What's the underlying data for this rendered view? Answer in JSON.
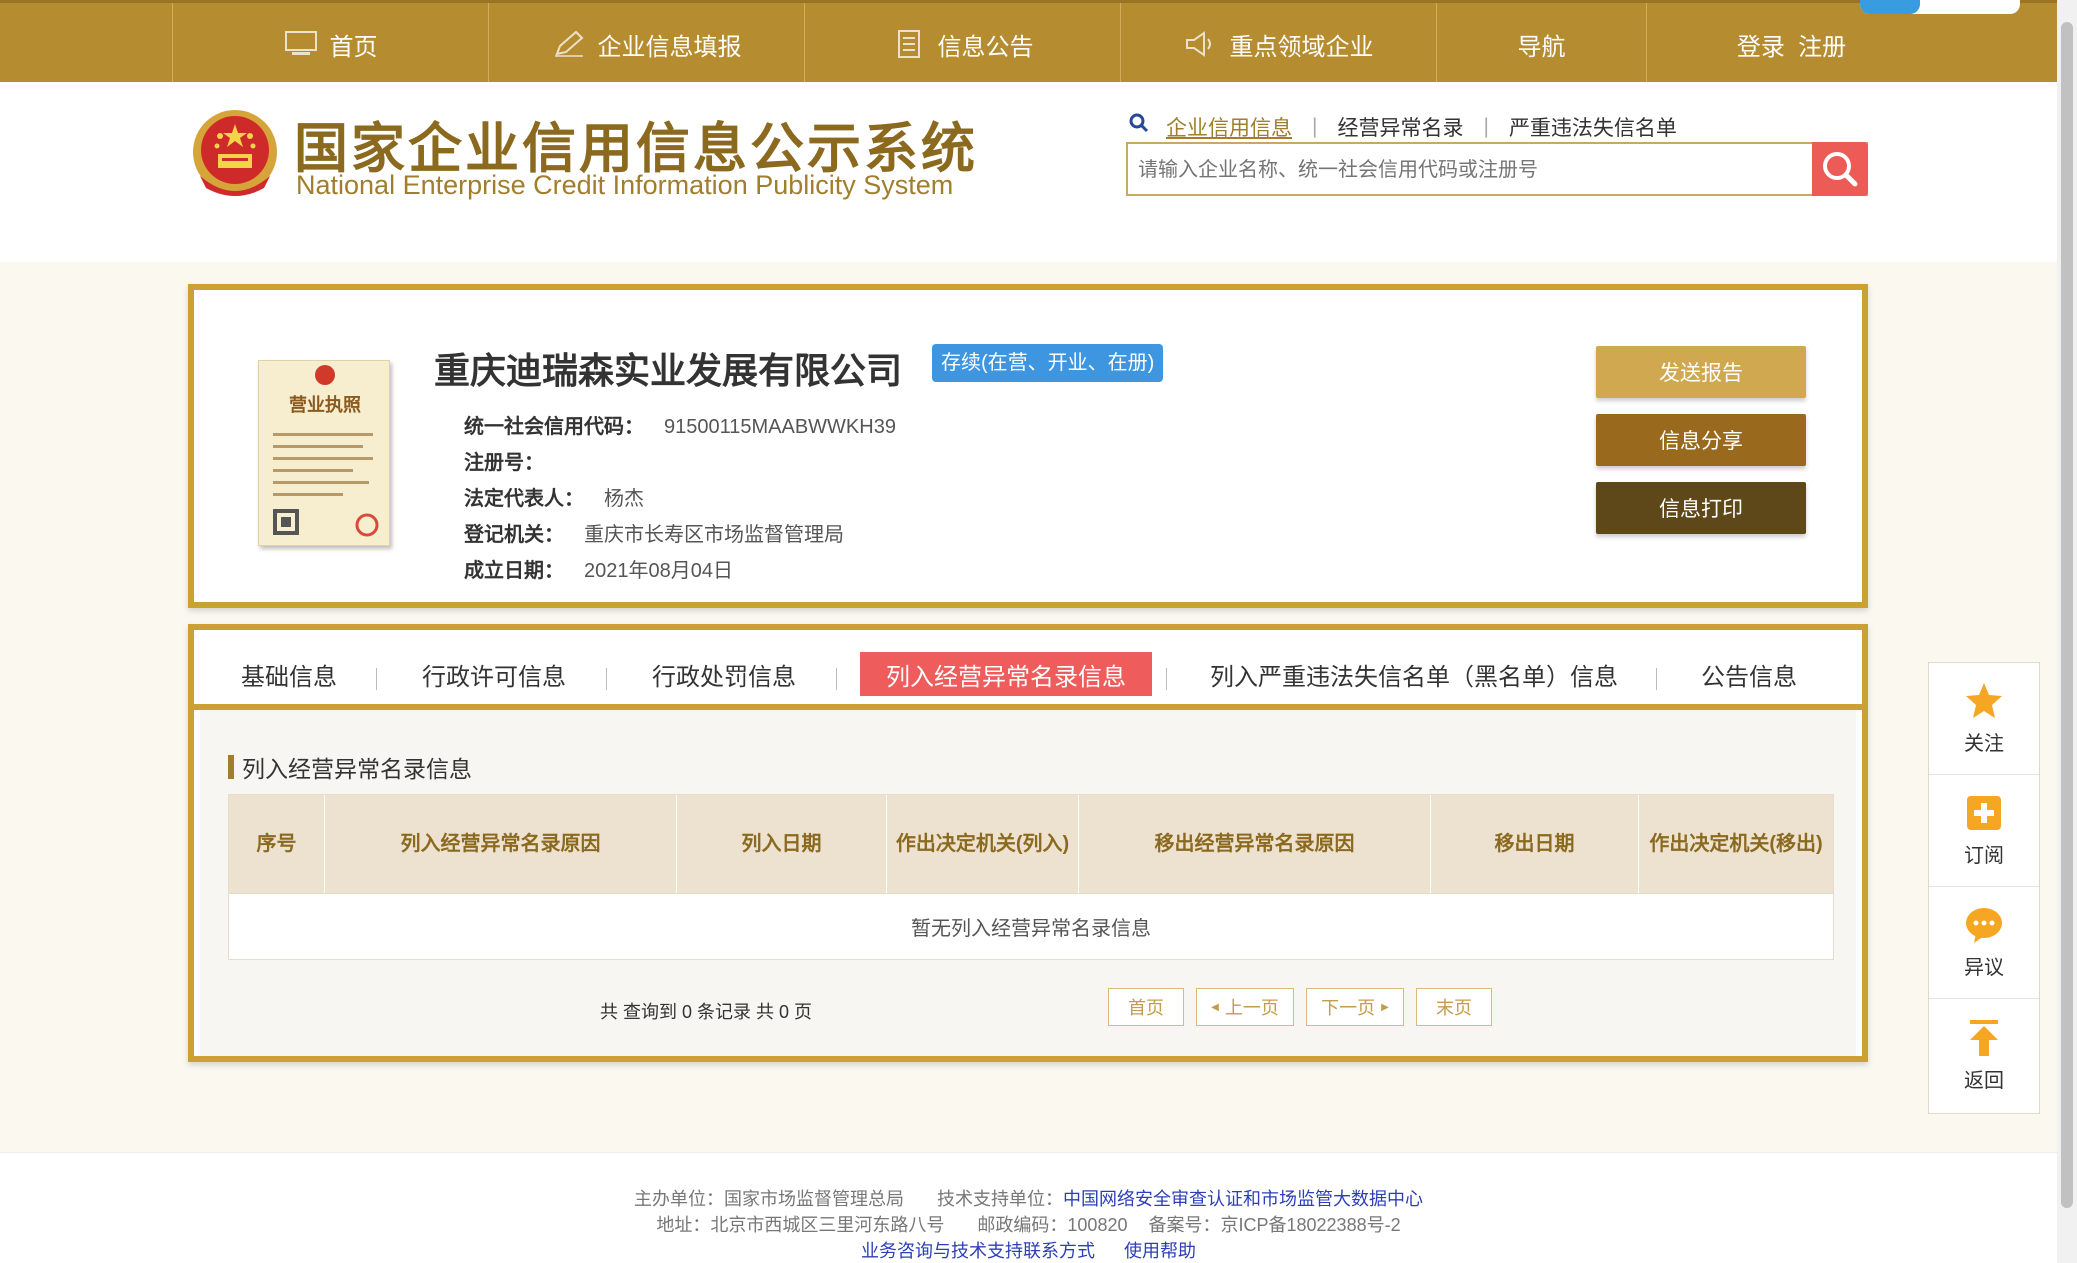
{
  "nav": {
    "items": [
      {
        "label": "首页",
        "icon": "monitor-icon"
      },
      {
        "label": "企业信息填报",
        "icon": "pen-icon"
      },
      {
        "label": "信息公告",
        "icon": "document-icon"
      },
      {
        "label": "重点领域企业",
        "icon": "megaphone-icon"
      },
      {
        "label": "导航",
        "icon": ""
      },
      {
        "label": "登录  注册",
        "icon": ""
      }
    ]
  },
  "header": {
    "title_cn": "国家企业信用信息公示系统",
    "title_en": "National Enterprise Credit Information Publicity System",
    "search_tabs": [
      "企业信用信息",
      "经营异常名录",
      "严重违法失信名单"
    ],
    "search_placeholder": "请输入企业名称、统一社会信用代码或注册号"
  },
  "company": {
    "name": "重庆迪瑞森实业发展有限公司",
    "status": "存续(在营、开业、在册)",
    "fields": [
      {
        "label": "统一社会信用代码：",
        "value": "91500115MAABWWKH39"
      },
      {
        "label": "注册号：",
        "value": ""
      },
      {
        "label": "法定代表人：",
        "value": "杨杰"
      },
      {
        "label": "登记机关：",
        "value": "重庆市长寿区市场监督管理局"
      },
      {
        "label": "成立日期：",
        "value": "2021年08月04日"
      }
    ],
    "license_text": "营业执照",
    "buttons": {
      "report": "发送报告",
      "share": "信息分享",
      "print": "信息打印"
    }
  },
  "tabs": [
    "基础信息",
    "行政许可信息",
    "行政处罚信息",
    "列入经营异常名录信息",
    "列入严重违法失信名单（黑名单）信息",
    "公告信息"
  ],
  "active_tab": "列入经营异常名录信息",
  "section": {
    "title": "列入经营异常名录信息",
    "columns": [
      "序号",
      "列入经营异常名录原因",
      "列入日期",
      "作出决定机关(列入)",
      "移出经营异常名录原因",
      "移出日期",
      "作出决定机关(移出)"
    ],
    "empty_text": "暂无列入经营异常名录信息",
    "pager": {
      "summary": "共 查询到 0 条记录 共 0 页",
      "first": "首页",
      "prev": "上一页",
      "next": "下一页",
      "last": "末页"
    }
  },
  "side": {
    "follow": "关注",
    "subscribe": "订阅",
    "objection": "异议",
    "back": "返回"
  },
  "footer": {
    "host_label": "主办单位：",
    "host": "国家市场监督管理总局",
    "support_label": "技术支持单位：",
    "support": "中国网络安全审查认证和市场监管大数据中心",
    "address": "地址：北京市西城区三里河东路八号",
    "postcode": "邮政编码：100820",
    "icp": "备案号：京ICP备18022388号-2",
    "consult": "业务咨询与技术支持联系方式",
    "help": "使用帮助"
  },
  "colors": {
    "gold": "#b58c30",
    "border": "#c9a233",
    "active_tab": "#ee5c5c",
    "status": "#3e95e0"
  }
}
